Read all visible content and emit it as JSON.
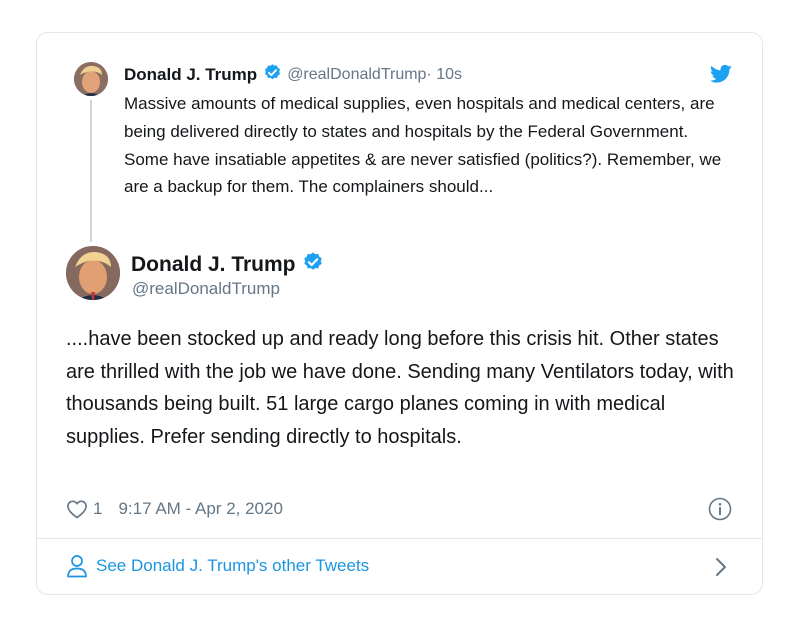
{
  "colors": {
    "accent": "#1da1f2",
    "link": "#1b95e0",
    "secondary_text": "#657786",
    "border": "#e1e8ed"
  },
  "parent_tweet": {
    "name": "Donald J. Trump",
    "handle": "@realDonaldTrump",
    "time": " · 10s",
    "text": "Massive amounts of medical supplies, even hospitals and medical centers, are being delivered directly to states and hospitals by the Federal Government. Some have insatiable appetites & are never satisfied (politics?). Remember, we are a backup for them. The complainers should...",
    "icons": [
      "verified-badge-icon",
      "twitter-bird-icon"
    ]
  },
  "tweet": {
    "name": "Donald J. Trump",
    "handle": "@realDonaldTrump",
    "text": "....have been stocked up and ready long before this crisis hit. Other states are thrilled with the job we have done. Sending many Ventilators today, with thousands being built. 51 large cargo planes coming in with medical supplies. Prefer sending directly to hospitals.",
    "likes": "1",
    "timestamp": "9:17 AM - Apr 2, 2020",
    "icons": [
      "verified-badge-icon",
      "heart-icon",
      "info-icon"
    ]
  },
  "footer": {
    "link_text": "See Donald J. Trump's other Tweets",
    "icons": [
      "person-icon",
      "chevron-right-icon"
    ]
  }
}
